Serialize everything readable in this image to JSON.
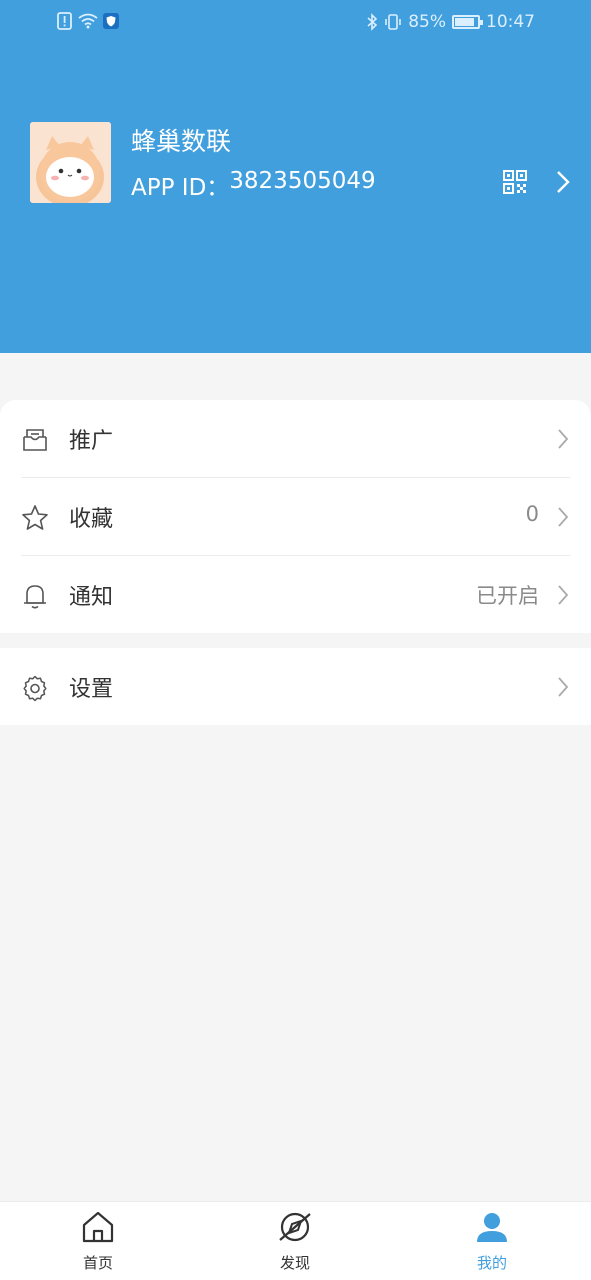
{
  "status_bar": {
    "battery_text": "85%",
    "battery_level": 0.85,
    "time": "10:47"
  },
  "profile": {
    "name": "蜂巢数联",
    "app_id_label": "APP ID：",
    "app_id": "3823505049"
  },
  "menu": {
    "promote": {
      "label": "推广",
      "icon": "inbox-icon"
    },
    "favorites": {
      "label": "收藏",
      "value": "0",
      "icon": "star-icon"
    },
    "notifications": {
      "label": "通知",
      "value": "已开启",
      "icon": "bell-icon"
    },
    "settings": {
      "label": "设置",
      "icon": "gear-icon"
    }
  },
  "tabbar": {
    "tabs": [
      {
        "label": "首页",
        "icon": "home-icon",
        "active": false
      },
      {
        "label": "发现",
        "icon": "compass-icon",
        "active": false
      },
      {
        "label": "我的",
        "icon": "user-icon",
        "active": true
      }
    ]
  },
  "colors": {
    "primary": "#419fde",
    "background": "#f5f5f5",
    "text": "#333333",
    "muted": "#8a8a8a"
  }
}
